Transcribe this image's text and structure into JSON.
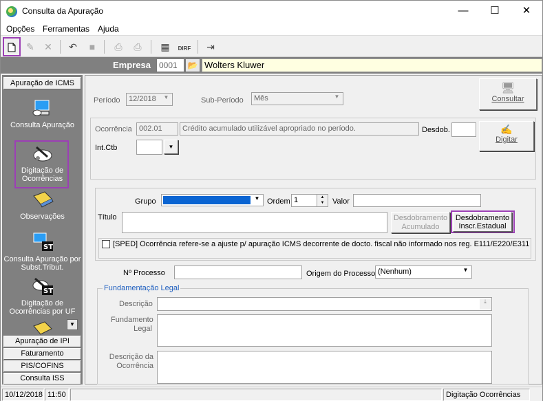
{
  "window": {
    "title": "Consulta da Apuração",
    "minimize": "—",
    "maximize": "☐",
    "close": "✕"
  },
  "menu": [
    {
      "label": "Opções"
    },
    {
      "label": "Ferramentas"
    },
    {
      "label": "Ajuda"
    }
  ],
  "toolbar": {
    "icons": [
      "new-document",
      "edit",
      "delete",
      "undo",
      "stop",
      "print",
      "print-preview",
      "calculator",
      "dirf",
      "exit"
    ]
  },
  "empresa": {
    "label": "Empresa",
    "code": "0001",
    "name": "Wolters Kluwer"
  },
  "sidebar": {
    "header": "Apuração de ICMS",
    "items": [
      {
        "label": "Consulta Apuração",
        "icon": "computer-icon"
      },
      {
        "label": "Digitação de Ocorrências",
        "icon": "writing-icon"
      },
      {
        "label": "Observações",
        "icon": "notebook-icon"
      },
      {
        "label": "Consulta Apuração por Subst.Tribut.",
        "icon": "st-computer-icon"
      },
      {
        "label": "Digitação de Ocorrências por UF",
        "icon": "st-writing-icon"
      }
    ],
    "footer": [
      "Apuração de IPI",
      "Faturamento",
      "PIS/COFINS",
      "Consulta ISS"
    ]
  },
  "form": {
    "periodo_label": "Período",
    "periodo_value": "12/2018",
    "subperiodo_label": "Sub-Período",
    "subperiodo_value": "Mês",
    "consultar_label": "Consultar",
    "ocorrencia_label": "Ocorrência",
    "ocorrencia_code": "002.01",
    "ocorrencia_desc": "Crédito acumulado utilizável apropriado no período.",
    "desdob_label": "Desdob.",
    "desdob_value": "",
    "intctb_label": "Int.Ctb",
    "intctb_value": "",
    "digitar_label": "Digitar",
    "grupo_label": "Grupo",
    "ordem_label": "Ordem",
    "ordem_value": "1",
    "valor_label": "Valor",
    "valor_value": "",
    "titulo_label": "Título",
    "titulo_value": "",
    "desdob_acumulado_label": "Desdobramento Acumulado",
    "desdob_inscr_label": "Desdobramento Inscr.Estadual",
    "sped_label": "[SPED] Ocorrência refere-se a ajuste p/ apuração ICMS decorrente de docto. fiscal não informado nos reg. E111/E220/E311",
    "processo_label": "Nº Processo",
    "processo_value": "",
    "origem_label": "Origem do Processo",
    "origem_value": "(Nenhum)",
    "fundamentacao_label": "Fundamentação Legal",
    "descricao_label": "Descrição",
    "fundamento_label": "Fundamento Legal",
    "descricao_ocorrencia_label": "Descrição da Ocorrência"
  },
  "status": {
    "date": "10/12/2018",
    "time": "11:50",
    "mode": "Digitação Ocorrências"
  },
  "colors": {
    "highlight": "#9c3fb5",
    "empresa_bg": "#808080",
    "name_bg": "#ffffe1",
    "grupo_selected": "#0a64d2"
  }
}
